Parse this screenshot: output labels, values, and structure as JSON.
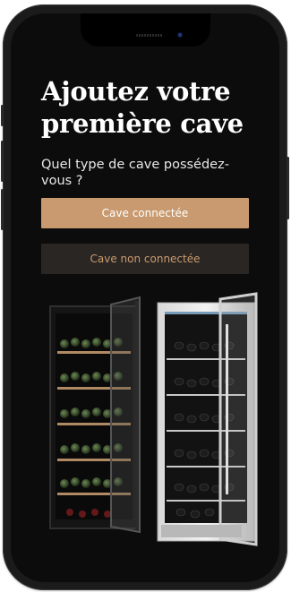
{
  "onboarding": {
    "title": "Ajoutez votre première cave",
    "subtitle": "Quel type de cave possédez-vous ?",
    "connected_button": "Cave connectée",
    "not_connected_button": "Cave non connectée"
  },
  "colors": {
    "screen_bg": "#0c0c0c",
    "accent": "#c99a6f",
    "secondary_button_bg": "#2a2623"
  },
  "images": {
    "left": "black-wine-cellar-glass-door",
    "right": "stainless-wine-cellar-glass-door"
  }
}
